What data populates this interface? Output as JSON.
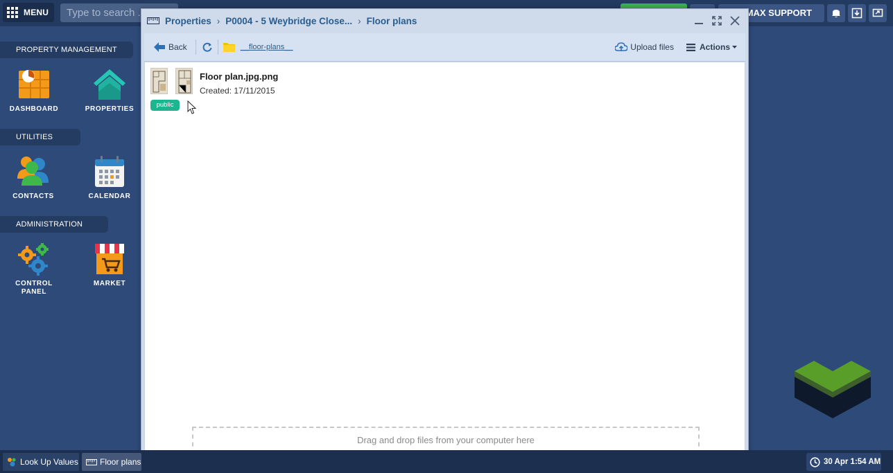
{
  "topbar": {
    "menu_label": "MENU",
    "search_placeholder": "Type to search ...",
    "support_label": "IDMAX SUPPORT"
  },
  "sections": [
    {
      "label": "PROPERTY MANAGEMENT"
    },
    {
      "label": "UTILITIES"
    },
    {
      "label": "ADMINISTRATION"
    }
  ],
  "tiles": [
    {
      "label": "DASHBOARD",
      "icon": "dashboard-icon"
    },
    {
      "label": "PROPERTIES",
      "icon": "house-icon"
    },
    {
      "label": "CONTACTS",
      "icon": "people-icon"
    },
    {
      "label": "CALENDAR",
      "icon": "calendar-icon"
    },
    {
      "label": "CONTROL PANEL",
      "icon": "gears-icon"
    },
    {
      "label": "MARKET",
      "icon": "market-icon"
    }
  ],
  "window": {
    "breadcrumb": [
      "Properties",
      "P0004 - 5 Weybridge Close...",
      "Floor plans"
    ],
    "toolbar": {
      "back_label": "Back",
      "folder_label": "__floor-plans__",
      "upload_label": "Upload files",
      "actions_label": "Actions"
    },
    "file": {
      "name": "Floor plan.jpg.png",
      "created_label": "Created:",
      "created_date": "17/11/2015",
      "badge": "public"
    },
    "dropzone_text": "Drag and drop files from your computer here"
  },
  "taskbar": {
    "items": [
      {
        "label": "Look Up Values"
      },
      {
        "label": "Floor plans"
      }
    ],
    "clock": "30 Apr 1:54 AM"
  },
  "colors": {
    "desktop_bg": "#2e4a78",
    "badge_green": "#1cb58f",
    "link_blue": "#2a5d8f"
  }
}
